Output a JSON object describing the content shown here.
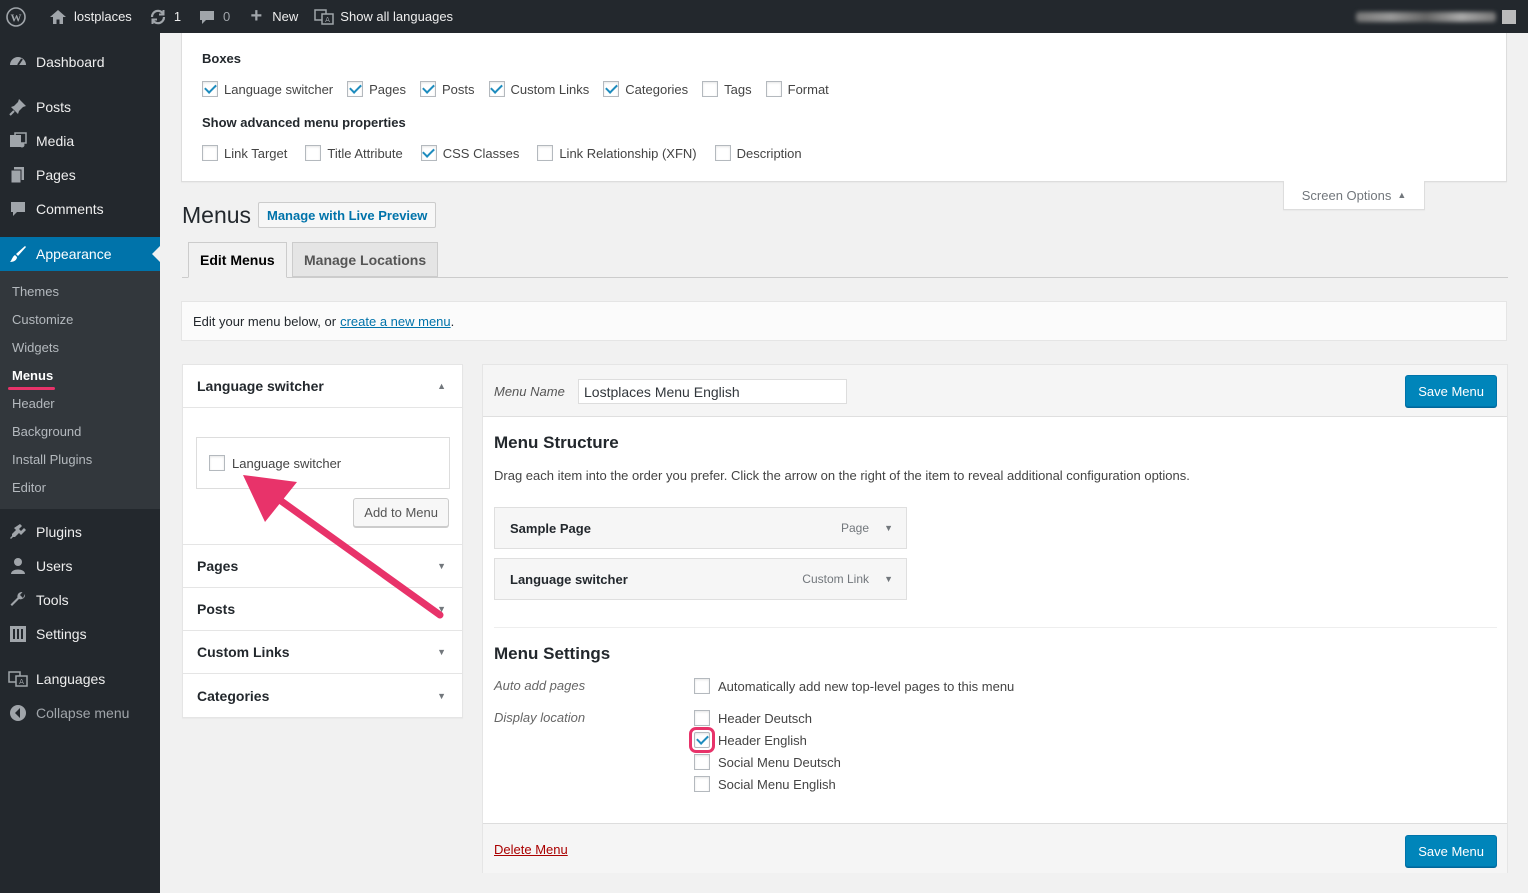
{
  "adminbar": {
    "site_name": "lostplaces",
    "updates_count": "1",
    "comments_count": "0",
    "new_label": "New",
    "languages_label": "Show all languages"
  },
  "sidebar": {
    "items_top": [
      {
        "label": "Dashboard",
        "icon": "dashboard-icon"
      },
      {
        "label": "Posts",
        "icon": "pin-icon"
      },
      {
        "label": "Media",
        "icon": "media-icon"
      },
      {
        "label": "Pages",
        "icon": "pages-icon"
      },
      {
        "label": "Comments",
        "icon": "comments-icon"
      }
    ],
    "current": {
      "label": "Appearance",
      "icon": "paintbrush-icon"
    },
    "submenu": [
      "Themes",
      "Customize",
      "Widgets",
      "Menus",
      "Header",
      "Background",
      "Install Plugins",
      "Editor"
    ],
    "items_bottom": [
      {
        "label": "Plugins",
        "icon": "plugin-icon"
      },
      {
        "label": "Users",
        "icon": "users-icon"
      },
      {
        "label": "Tools",
        "icon": "wrench-icon"
      },
      {
        "label": "Settings",
        "icon": "settings-icon"
      },
      {
        "label": "Languages",
        "icon": "translation-icon"
      },
      {
        "label": "Collapse menu",
        "icon": "collapse-icon"
      }
    ]
  },
  "screen_options": {
    "boxes_heading": "Boxes",
    "boxes": [
      {
        "label": "Language switcher",
        "checked": true
      },
      {
        "label": "Pages",
        "checked": true
      },
      {
        "label": "Posts",
        "checked": true
      },
      {
        "label": "Custom Links",
        "checked": true
      },
      {
        "label": "Categories",
        "checked": true
      },
      {
        "label": "Tags",
        "checked": false
      },
      {
        "label": "Format",
        "checked": false
      }
    ],
    "advanced_heading": "Show advanced menu properties",
    "advanced": [
      {
        "label": "Link Target",
        "checked": false
      },
      {
        "label": "Title Attribute",
        "checked": false
      },
      {
        "label": "CSS Classes",
        "checked": true
      },
      {
        "label": "Link Relationship (XFN)",
        "checked": false
      },
      {
        "label": "Description",
        "checked": false
      }
    ],
    "tab_label": "Screen Options"
  },
  "page": {
    "title": "Menus",
    "live_preview_label": "Manage with Live Preview",
    "tabs": [
      "Edit Menus",
      "Manage Locations"
    ],
    "manage_text": "Edit your menu below, or",
    "create_link": "create a new menu",
    "manage_suffix": "."
  },
  "accordion": {
    "open_title": "Language switcher",
    "item_label": "Language switcher",
    "add_button": "Add to Menu",
    "sections": [
      "Pages",
      "Posts",
      "Custom Links",
      "Categories"
    ]
  },
  "menu_edit": {
    "name_label": "Menu Name",
    "name_value": "Lostplaces Menu English",
    "save_label": "Save Menu",
    "structure_title": "Menu Structure",
    "structure_desc": "Drag each item into the order you prefer. Click the arrow on the right of the item to reveal additional configuration options.",
    "items": [
      {
        "title": "Sample Page",
        "type": "Page"
      },
      {
        "title": "Language switcher",
        "type": "Custom Link"
      }
    ],
    "settings_title": "Menu Settings",
    "auto_add_label": "Auto add pages",
    "auto_add_text": "Automatically add new top-level pages to this menu",
    "display_location_label": "Display location",
    "locations": [
      {
        "label": "Header Deutsch",
        "checked": false
      },
      {
        "label": "Header English",
        "checked": true
      },
      {
        "label": "Social Menu Deutsch",
        "checked": false
      },
      {
        "label": "Social Menu English",
        "checked": false
      }
    ],
    "delete_label": "Delete Menu"
  },
  "colors": {
    "accent": "#0073aa",
    "primary_button": "#0085ba",
    "annotation": "#e8336a",
    "sidebar_bg": "#23282d"
  }
}
